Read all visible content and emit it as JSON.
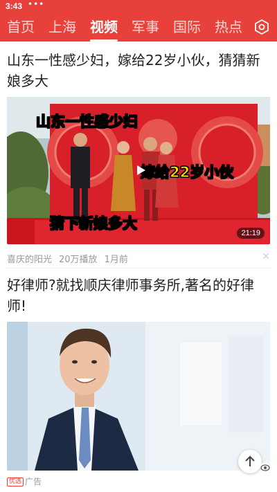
{
  "status_bar": {
    "time": "3:43",
    "dots": "•••"
  },
  "nav": {
    "tabs": [
      {
        "label": "首页"
      },
      {
        "label": "上海"
      },
      {
        "label": "视频"
      },
      {
        "label": "军事"
      },
      {
        "label": "国际"
      },
      {
        "label": "热点"
      }
    ],
    "active_tab": "视频",
    "more_icon": "hexagon-settings-icon"
  },
  "colors": {
    "brand": "#e8403a",
    "meta_text": "#999999"
  },
  "feed": [
    {
      "title": "山东一性感少妇，嫁给22岁小伙，猜猜新娘多大",
      "video": {
        "captions": [
          "山东一性感少妇",
          "嫁给22岁小伙",
          "猜下新娘多大"
        ],
        "duration": "21:19"
      },
      "source": "喜庆的阳光",
      "plays": "20万播放",
      "time": "1月前"
    },
    {
      "title": "好律师?就找顺庆律师事务所,著名的好律师!",
      "ad_tag": "优选",
      "ad_label": "广告"
    }
  ]
}
